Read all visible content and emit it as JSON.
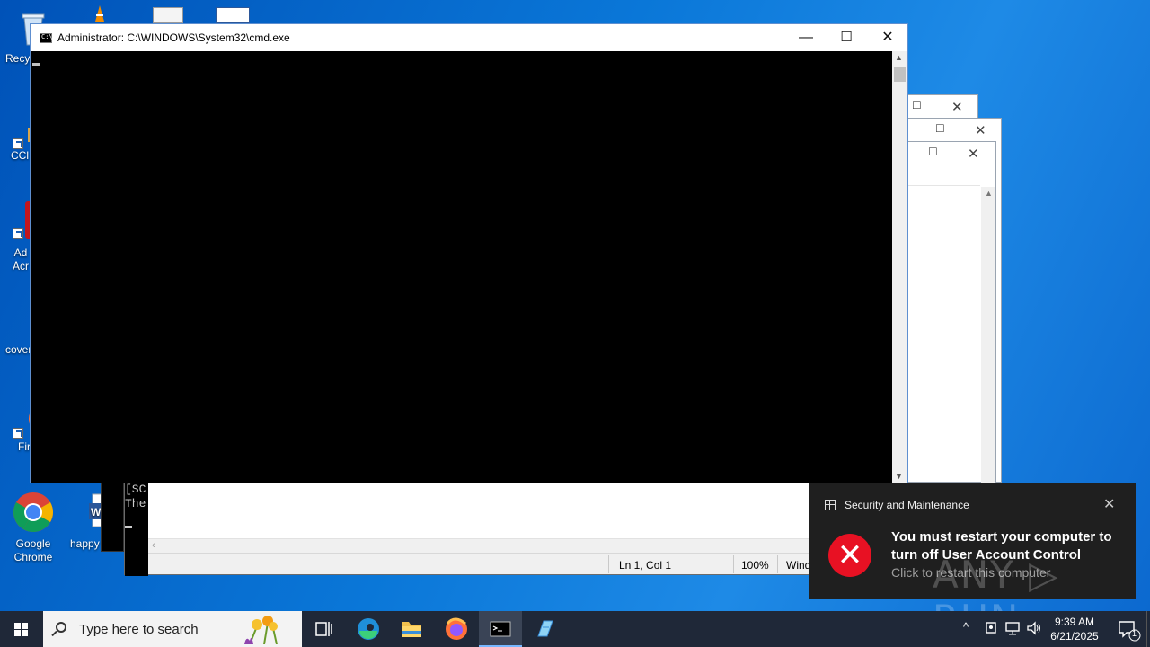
{
  "cmd_window": {
    "title": "Administrator: C:\\WINDOWS\\System32\\cmd.exe",
    "minimize_glyph": "—",
    "maximize_glyph": "☐",
    "close_glyph": "✕"
  },
  "desktop_icons": [
    {
      "label": "Recy"
    },
    {
      "label": "CCl"
    },
    {
      "label": "Ad\nAcr"
    },
    {
      "label": "cover"
    },
    {
      "label": "Fir"
    },
    {
      "label": "Google\nChrome"
    },
    {
      "label": "happy"
    }
  ],
  "console_behind": {
    "lines": [
      "[SC",
      "The"
    ]
  },
  "notepad": {
    "status_position": "Ln 1, Col 1",
    "status_zoom": "100%",
    "status_eol": "Wind"
  },
  "toast": {
    "app_name": "Security and Maintenance",
    "message": "You must restart your computer to turn off User Account Control",
    "sub_text": "Click to restart this computer",
    "close_glyph": "✕",
    "watermark": "ANY ▷ RUN",
    "accent_color": "#e81123"
  },
  "taskbar": {
    "search_placeholder": "Type here to search",
    "time": "9:39 AM",
    "date": "6/21/2025",
    "notification_count": "1"
  }
}
